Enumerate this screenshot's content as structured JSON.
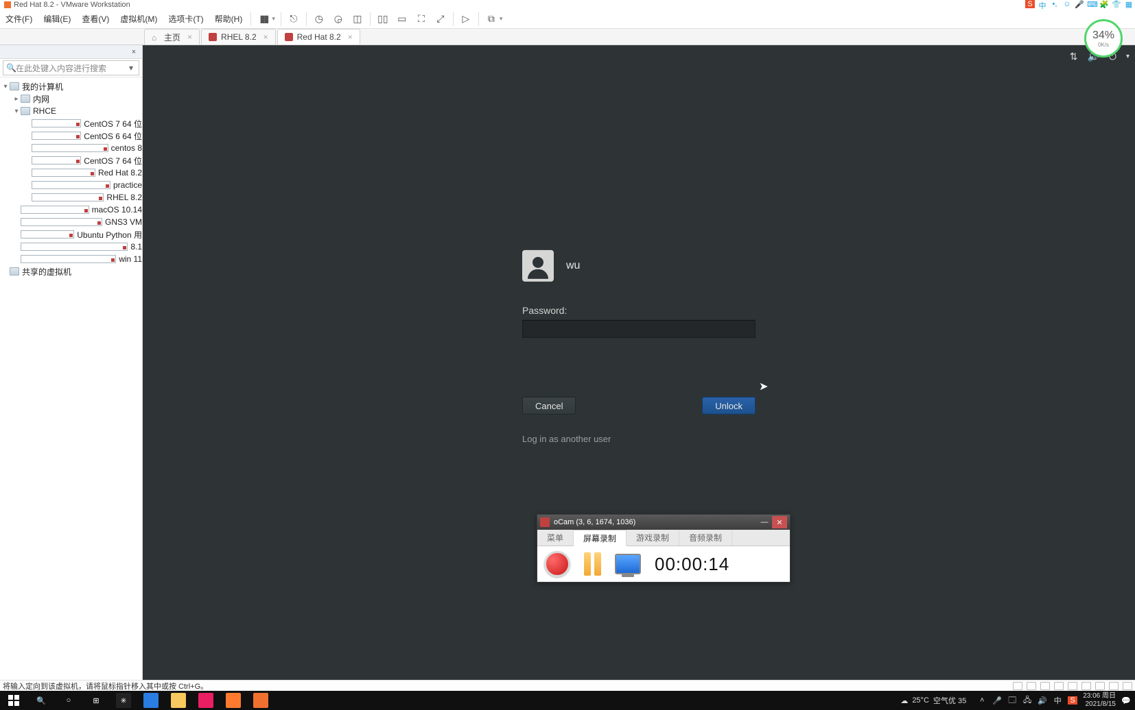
{
  "app": {
    "title": "Red Hat 8.2 - VMware Workstation"
  },
  "menubar": {
    "items": [
      "文件(F)",
      "编辑(E)",
      "查看(V)",
      "虚拟机(M)",
      "选项卡(T)",
      "帮助(H)"
    ]
  },
  "perf": {
    "pct": "34%",
    "sub": "0K/s"
  },
  "tabs": [
    {
      "label": "主页",
      "kind": "home",
      "active": false
    },
    {
      "label": "RHEL 8.2",
      "kind": "vm",
      "active": false
    },
    {
      "label": "Red Hat 8.2",
      "kind": "vm",
      "active": true
    }
  ],
  "sidebar": {
    "search_placeholder": "在此处键入内容进行搜索",
    "root": "我的计算机",
    "shared": "共享的虚拟机",
    "nodes": {
      "neiwang": "内网",
      "rhce": "RHCE",
      "c7_1": "CentOS 7 64 位",
      "c6": "CentOS 6 64 位",
      "c8": "centos 8",
      "c7_2": "CentOS 7 64 位",
      "rh82": "Red Hat 8.2",
      "practice": "practice",
      "rhel82": "RHEL 8.2",
      "mac": "macOS 10.14",
      "gns3": "GNS3 VM",
      "ubuntu": "Ubuntu Python 用",
      "eight1": "8.1",
      "win11": "win 11"
    }
  },
  "login": {
    "username": "wu",
    "password_label": "Password:",
    "cancel": "Cancel",
    "unlock": "Unlock",
    "other": "Log in as another user"
  },
  "statusbar": {
    "text": "将输入定向到该虚拟机，请将鼠标指针移入其中或按 Ctrl+G。"
  },
  "ocam": {
    "title": "oCam (3, 6, 1674, 1036)",
    "tabs": [
      "菜单",
      "屏幕录制",
      "游戏录制",
      "音频录制"
    ],
    "active_tab": 1,
    "time": "00:00:14"
  },
  "taskbar": {
    "weather_temp": "25°C",
    "weather_text": "空气优 35",
    "ime": "中",
    "clock_time": "23:06",
    "clock_day": "周日",
    "clock_date": "2021/8/15"
  }
}
